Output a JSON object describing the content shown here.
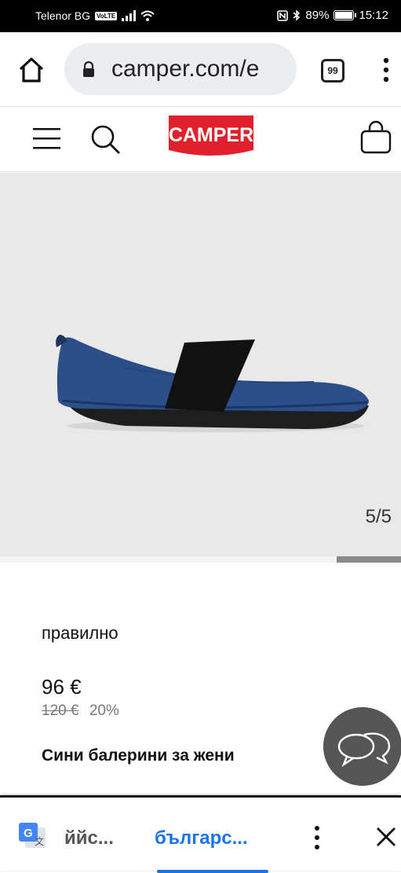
{
  "status_bar": {
    "carrier": "Telenor BG",
    "volte": "VoLTE",
    "battery": "89%",
    "battery_level": 0.89,
    "time": "15:12"
  },
  "browser": {
    "url": "camper.com/e",
    "tab_count": "99"
  },
  "site": {
    "logo_text": "CAMPER",
    "brand_color": "#e0202b"
  },
  "gallery": {
    "counter": "5/5",
    "current": 5,
    "total": 5,
    "background": "#e9e9e9"
  },
  "product": {
    "tag": "правилно",
    "price": "96 €",
    "old_price": "120 €",
    "discount": "20%",
    "name": "Сини балерини за жени"
  },
  "translate_bar": {
    "source_language": "ййс...",
    "target_language": "българс...",
    "accent": "#1a73e8"
  }
}
